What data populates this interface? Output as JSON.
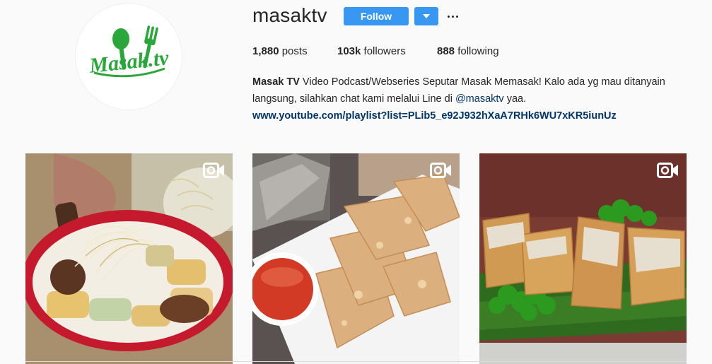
{
  "profile": {
    "username": "masaktv",
    "avatar_icon": "masak-tv-logo",
    "avatar_text": "Masak.tv",
    "follow_label": "Follow",
    "dropdown_icon": "chevron-down-icon",
    "more_icon": "more-horizontal-icon"
  },
  "stats": {
    "posts_count": "1,880",
    "posts_label": " posts",
    "followers_count": "103k",
    "followers_label": " followers",
    "following_count": "888",
    "following_label": " following"
  },
  "bio": {
    "name": "Masak TV",
    "text1": " Video Podcast/Webseries Seputar Masak Memasak! Kalo ada yg mau ditanyain langsung, silahkan chat kami melalui Line di ",
    "mention": "@masaktv",
    "text2": " yaa.",
    "link": "www.youtube.com/playlist?list=PLib5_e92J932hXaA7RHk6WU7xKR5iunUz"
  },
  "posts": [
    {
      "type": "video",
      "icon": "video-camera-icon",
      "subject": "gado-gado salad with bean sprouts"
    },
    {
      "type": "video",
      "icon": "video-camera-icon",
      "subject": "fried dumplings with chili sauce"
    },
    {
      "type": "video",
      "icon": "video-camera-icon",
      "subject": "fried tofu with lettuce"
    }
  ],
  "colors": {
    "accent": "#3897f0",
    "logo_green": "#2aa63a",
    "link": "#003569"
  }
}
